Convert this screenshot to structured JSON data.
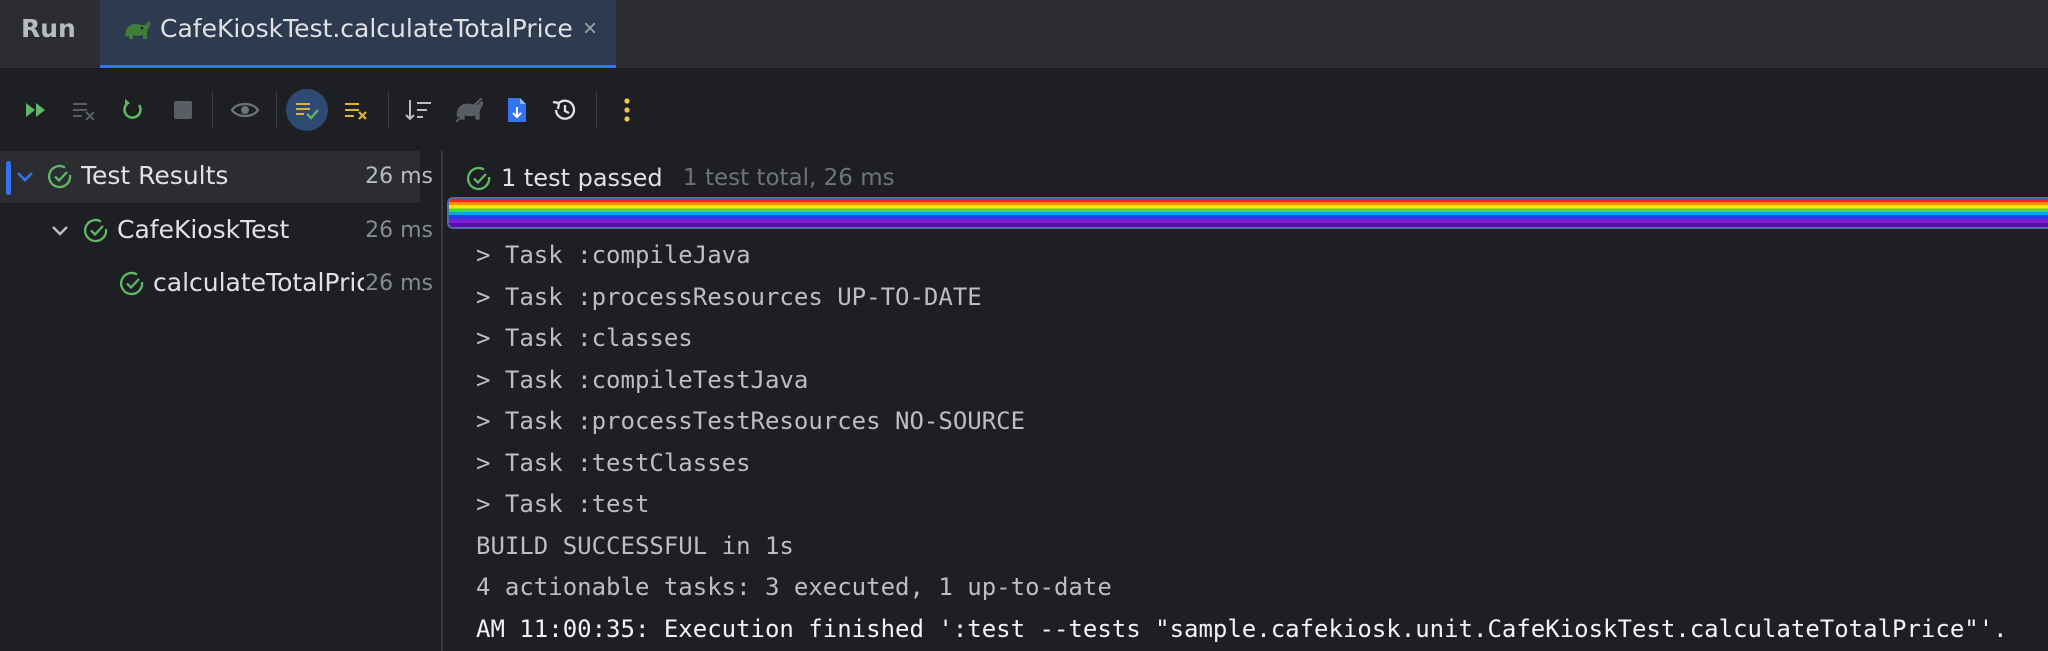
{
  "tabbar": {
    "run_label": "Run",
    "active_tab": {
      "title": "CafeKioskTest.calculateTotalPrice",
      "icon": "gradle-elephant-icon",
      "close": "×"
    }
  },
  "toolbar": {
    "buttons": [
      {
        "name": "rerun-failed-button",
        "icon": "double-play-icon"
      },
      {
        "name": "rerun-failed-tests-button",
        "icon": "list-x-icon"
      },
      {
        "name": "rerun-button",
        "icon": "rerun-icon"
      },
      {
        "name": "stop-button",
        "icon": "stop-icon"
      },
      {
        "name": "show-ignored-button",
        "icon": "eye-icon"
      },
      {
        "name": "show-passed-button",
        "icon": "list-check-icon"
      },
      {
        "name": "show-failed-button",
        "icon": "list-x-yellow-icon"
      },
      {
        "name": "sort-button",
        "icon": "sort-icon"
      },
      {
        "name": "gradle-button",
        "icon": "gradle-elephant-icon"
      },
      {
        "name": "import-tests-button",
        "icon": "import-file-icon"
      },
      {
        "name": "test-history-button",
        "icon": "history-icon"
      },
      {
        "name": "more-button",
        "icon": "kebab-vertical-icon"
      }
    ]
  },
  "tree": {
    "items": [
      {
        "label": "Test Results",
        "time": "26 ms"
      },
      {
        "label": "CafeKioskTest",
        "time": "26 ms"
      },
      {
        "label": "calculateTotalPrice",
        "time": "26 ms"
      }
    ]
  },
  "console": {
    "status_passed": "1 test passed",
    "status_total": "1 test total, 26 ms",
    "progress_percent": 100,
    "lines": [
      "> Task :compileJava",
      "> Task :processResources UP-TO-DATE",
      "> Task :classes",
      "> Task :compileTestJava",
      "> Task :processTestResources NO-SOURCE",
      "> Task :testClasses",
      "> Task :test",
      "BUILD SUCCESSFUL in 1s",
      "4 actionable tasks: 3 executed, 1 up-to-date",
      "AM 11:00:35: Execution finished ':test --tests \"sample.cafekiosk.unit.CafeKioskTest.calculateTotalPrice\"'."
    ]
  },
  "colors": {
    "accent": "#3574f0",
    "pass_green": "#5fb865",
    "background": "#1e1f22"
  }
}
